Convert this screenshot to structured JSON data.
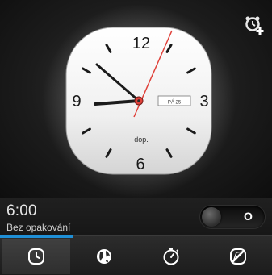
{
  "clock": {
    "numerals": [
      "12",
      "3",
      "6",
      "9"
    ],
    "date_window": "PÁ 25",
    "period_label": "dop."
  },
  "alarm": {
    "time": "6:00",
    "repeat": "Bez opakování",
    "toggle_label": "O",
    "enabled": false
  },
  "tabs": [
    {
      "icon": "alarm-clock-icon",
      "active": true
    },
    {
      "icon": "globe-icon",
      "active": false
    },
    {
      "icon": "stopwatch-icon",
      "active": false
    },
    {
      "icon": "timer-icon",
      "active": false
    }
  ],
  "colors": {
    "accent": "#1f8fd6",
    "second_hand": "#e0413a"
  }
}
